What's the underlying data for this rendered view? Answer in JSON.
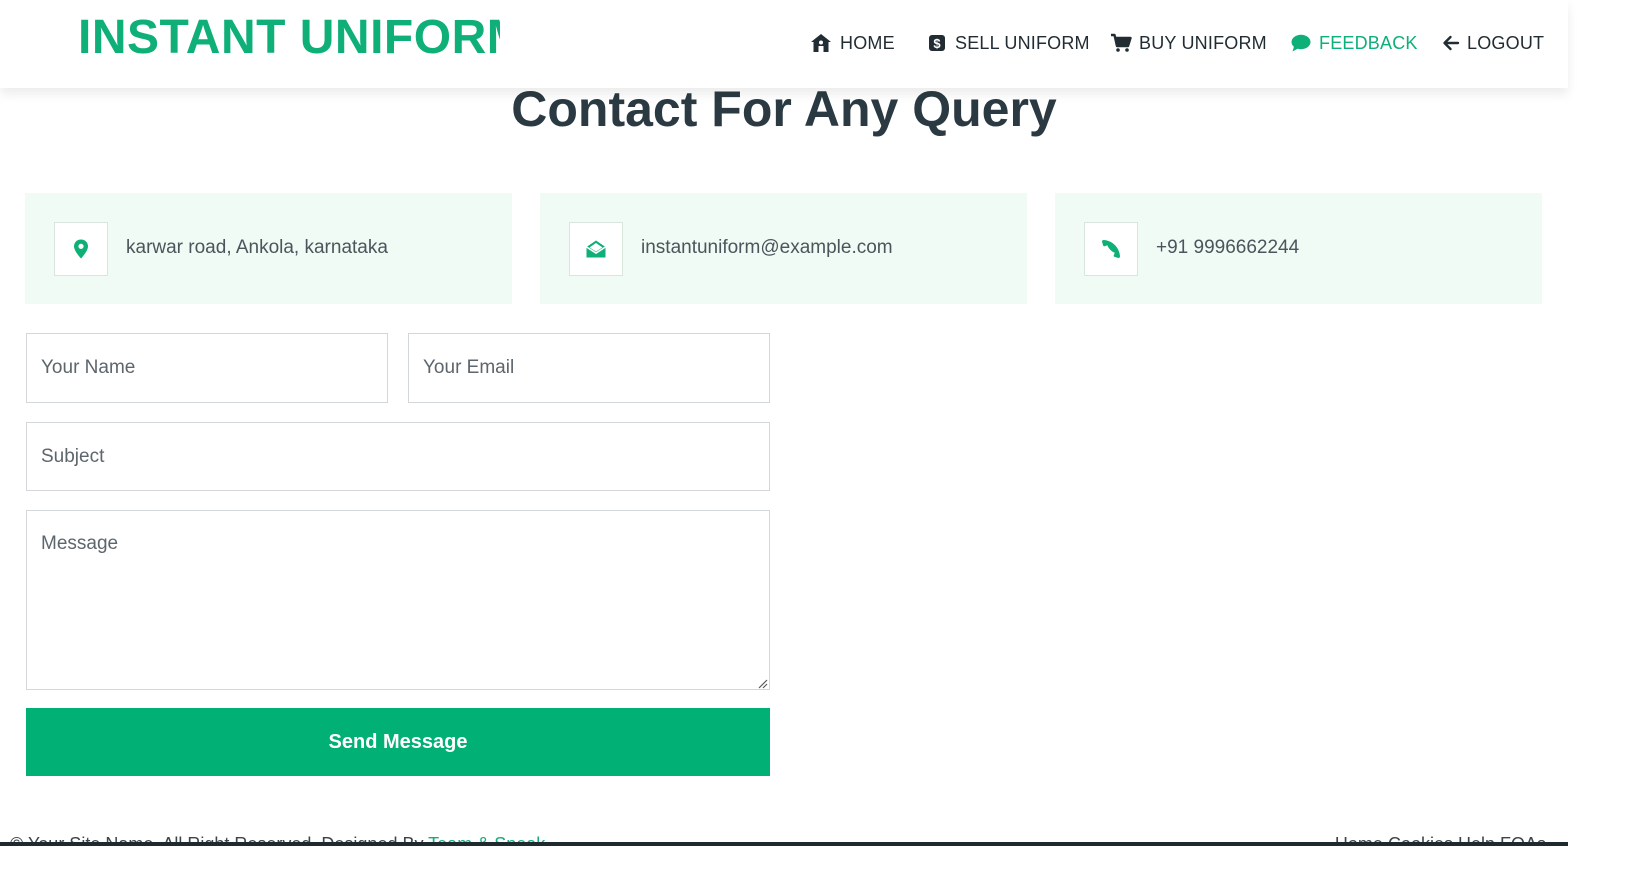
{
  "brand": {
    "name": "INSTANT UNIFORM",
    "color": "#0fb077"
  },
  "nav": {
    "items": [
      {
        "label": "HOME",
        "icon": "home-icon"
      },
      {
        "label": "SELL UNIFORM",
        "icon": "dollar-icon"
      },
      {
        "label": "BUY UNIFORM",
        "icon": "cart-icon"
      },
      {
        "label": "FEEDBACK",
        "icon": "comment-icon",
        "active": true
      },
      {
        "label": "LOGOUT",
        "icon": "arrow-left-icon"
      }
    ]
  },
  "contact": {
    "title": "Contact For Any Query",
    "cards": [
      {
        "text": "karwar road, Ankola, karnataka",
        "icon": "map-pin-icon"
      },
      {
        "text": "instantuniform@example.com",
        "icon": "envelope-open-icon"
      },
      {
        "text": "+91 9996662244",
        "icon": "phone-icon"
      }
    ],
    "form": {
      "name_placeholder": "Your Name",
      "email_placeholder": "Your Email",
      "subject_placeholder": "Subject",
      "message_placeholder": "Message",
      "submit_label": "Send Message"
    }
  },
  "footer": {
    "left_prefix": "© Your Site Name, All Right Reserved. Designed By",
    "left_link": "Team & Sneak",
    "right_links": "Home  Cookies  Help  FQAs"
  },
  "colors": {
    "accent": "#00b074",
    "card_bg": "#effbf4",
    "heading": "#2b3a42"
  }
}
